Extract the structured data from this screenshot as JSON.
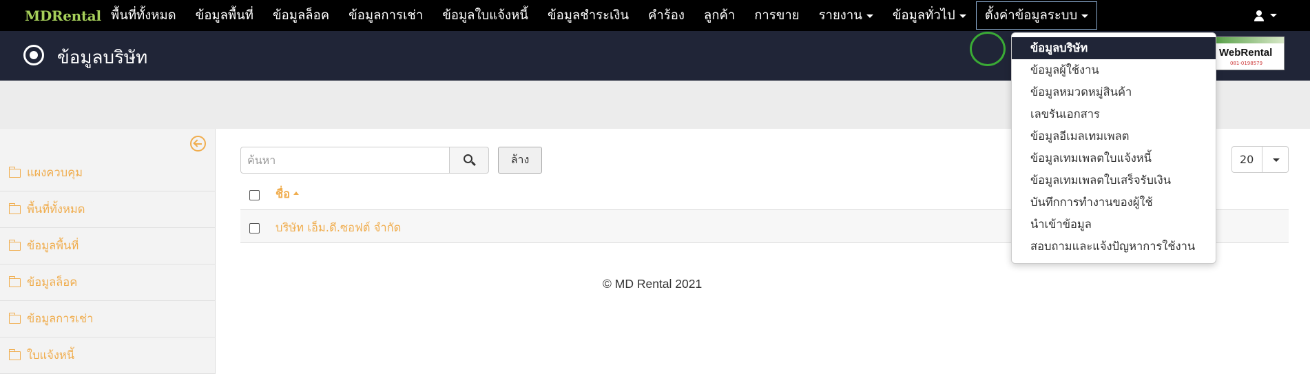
{
  "navbar": {
    "brand": "MDRental",
    "items": [
      {
        "label": "พื้นที่ทั้งหมด"
      },
      {
        "label": "ข้อมูลพื้นที่"
      },
      {
        "label": "ข้อมูลล็อค"
      },
      {
        "label": "ข้อมูลการเช่า"
      },
      {
        "label": "ข้อมูลใบแจ้งหนี้"
      },
      {
        "label": "ข้อมูลชำระเงิน"
      },
      {
        "label": "คำร้อง"
      },
      {
        "label": "ลูกค้า"
      },
      {
        "label": "การขาย"
      },
      {
        "label": "รายงาน"
      },
      {
        "label": "ข้อมูลทั่วไป"
      },
      {
        "label": "ตั้งค่าข้อมูลระบบ"
      }
    ]
  },
  "header": {
    "title": "ข้อมูลบริษัท",
    "logo": {
      "text": "WebRental",
      "phone": "081-0198579"
    }
  },
  "dropdown": {
    "items": [
      {
        "label": "ข้อมูลบริษัท"
      },
      {
        "label": "ข้อมูลผู้ใช้งาน"
      },
      {
        "label": "ข้อมูลหมวดหมู่สินค้า"
      },
      {
        "label": "เลขรันเอกสาร"
      },
      {
        "label": "ข้อมูลอีเมลเทมเพลต"
      },
      {
        "label": "ข้อมูลเทมเพลตใบแจ้งหนี้"
      },
      {
        "label": "ข้อมูลเทมเพลตใบเสร็จรับเงิน"
      },
      {
        "label": "บันทึกการทำงานของผู้ใช้"
      },
      {
        "label": "นำเข้าข้อมูล"
      },
      {
        "label": "สอบถามและแจ้งปัญหาการใช้งาน"
      }
    ]
  },
  "sidebar": {
    "items": [
      {
        "label": "แผงควบคุม"
      },
      {
        "label": "พื้นที่ทั้งหมด"
      },
      {
        "label": "ข้อมูลพื้นที่"
      },
      {
        "label": "ข้อมูลล็อค"
      },
      {
        "label": "ข้อมูลการเช่า"
      },
      {
        "label": "ใบแจ้งหนี้"
      }
    ]
  },
  "toolbar": {
    "search_placeholder": "ค้นหา",
    "clear_label": "ล้าง",
    "page_size": "20"
  },
  "table": {
    "column_name": "ชื่อ",
    "rows": [
      {
        "name": "บริษัท เอ็ม.ดี.ซอฟต์ จำกัด"
      }
    ]
  },
  "footer": {
    "text": "© MD Rental 2021"
  },
  "colors": {
    "accent": "#f0ad4e",
    "header_bg": "#202537",
    "brand": "#a6cf5a",
    "navbar_bg": "#000000"
  }
}
